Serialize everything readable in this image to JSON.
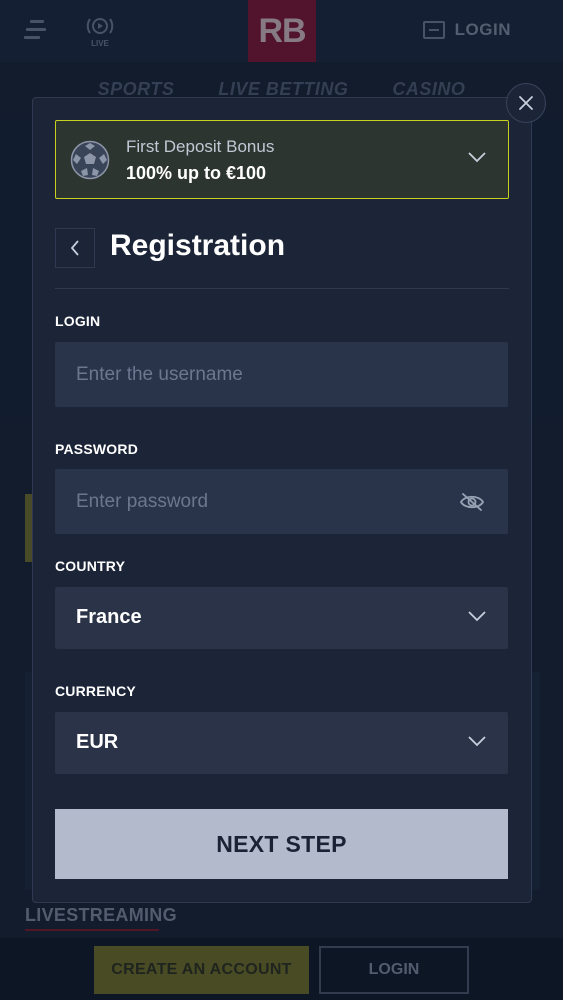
{
  "header": {
    "live_label": "LIVE",
    "logo_text": "RB",
    "login_label": "LOGIN"
  },
  "nav": {
    "tabs": [
      {
        "label": "SPORTS"
      },
      {
        "label": "LIVE BETTING"
      },
      {
        "label": "CASINO"
      }
    ]
  },
  "background": {
    "livestreaming_label": "LIVESTREAMING"
  },
  "footer": {
    "create_account_label": "CREATE AN ACCOUNT",
    "login_label": "LOGIN"
  },
  "modal": {
    "bonus": {
      "title": "First Deposit Bonus",
      "amount": "100% up to €100",
      "icon": "soccer-ball-icon"
    },
    "title": "Registration",
    "login": {
      "label": "LOGIN",
      "placeholder": "Enter the username",
      "value": ""
    },
    "password": {
      "label": "PASSWORD",
      "placeholder": "Enter password",
      "value": "",
      "icon": "eye-slash-icon"
    },
    "country": {
      "label": "COUNTRY",
      "value": "France"
    },
    "currency": {
      "label": "CURRENCY",
      "value": "EUR"
    },
    "next_label": "NEXT STEP"
  },
  "colors": {
    "page_bg": "#172236",
    "modal_bg": "#1c2538",
    "field_bg": "#29334a",
    "bonus_border": "#c8d21e",
    "next_button_bg": "#b3bacb",
    "brand_logo_bg": "#7a1636"
  }
}
